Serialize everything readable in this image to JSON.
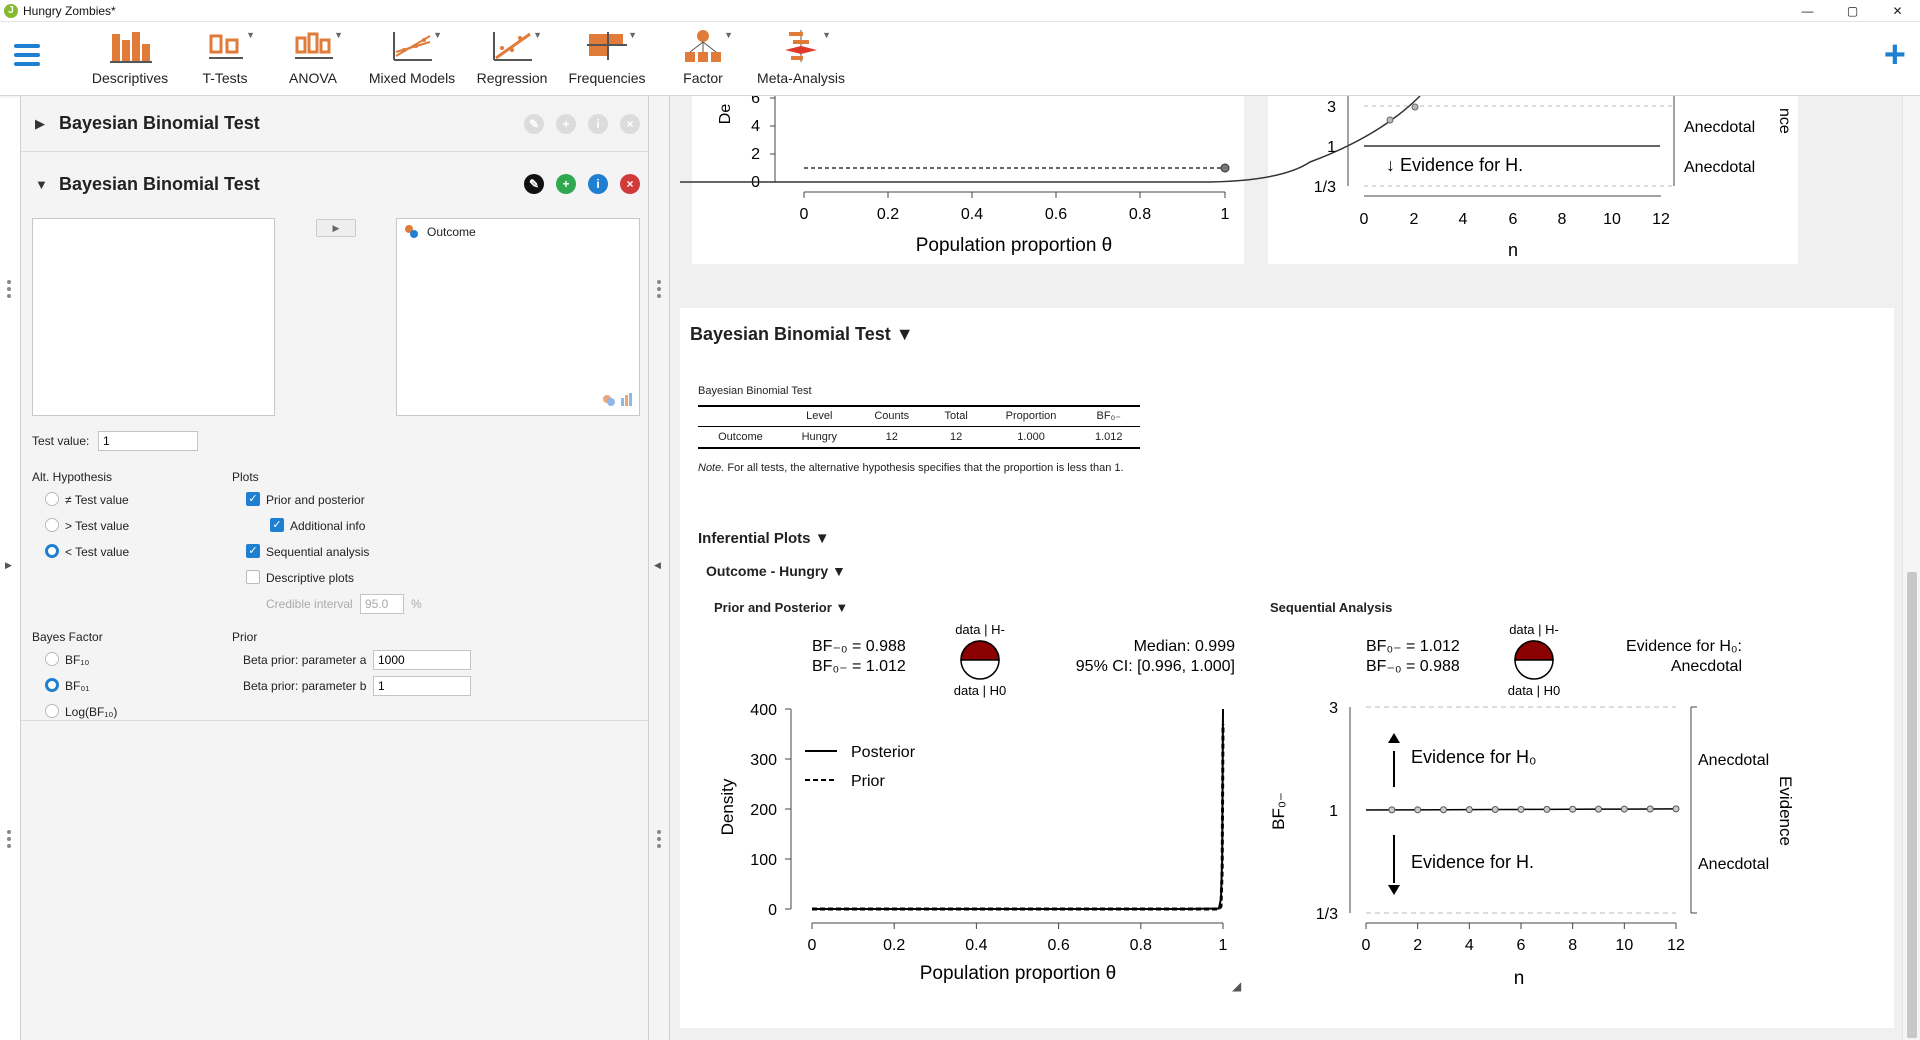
{
  "window": {
    "title": "Hungry Zombies*",
    "minimize": "—",
    "maximize": "▢",
    "close": "✕"
  },
  "ribbon": {
    "items": [
      {
        "label": "Descriptives"
      },
      {
        "label": "T-Tests"
      },
      {
        "label": "ANOVA"
      },
      {
        "label": "Mixed Models"
      },
      {
        "label": "Regression"
      },
      {
        "label": "Frequencies"
      },
      {
        "label": "Factor"
      },
      {
        "label": "Meta-Analysis"
      }
    ],
    "add": "+"
  },
  "options": {
    "collapsed_title": "Bayesian Binomial Test",
    "expanded_title": "Bayesian Binomial Test",
    "move_arrow": "▶",
    "assigned_variable": "Outcome",
    "test_value_label": "Test value:",
    "test_value": "1",
    "alt_hypothesis_title": "Alt. Hypothesis",
    "alt_hypothesis": [
      {
        "label": "≠ Test value",
        "checked": false
      },
      {
        "label": "> Test value",
        "checked": false
      },
      {
        "label": "< Test value",
        "checked": true
      }
    ],
    "plots_title": "Plots",
    "plots": [
      {
        "label": "Prior and posterior",
        "checked": true
      },
      {
        "label": "Additional info",
        "checked": true
      },
      {
        "label": "Sequential analysis",
        "checked": true
      },
      {
        "label": "Descriptive plots",
        "checked": false
      }
    ],
    "credible_interval_label": "Credible interval",
    "credible_interval_value": "95.0",
    "percent": "%",
    "bayes_factor_title": "Bayes Factor",
    "bayes_factor": [
      {
        "label": "BF₁₀",
        "checked": false
      },
      {
        "label": "BF₀₁",
        "checked": true
      },
      {
        "label": "Log(BF₁₀)",
        "checked": false
      }
    ],
    "prior_title": "Prior",
    "prior_a_label": "Beta prior: parameter a",
    "prior_a_value": "1000",
    "prior_b_label": "Beta prior: parameter b",
    "prior_b_value": "1"
  },
  "results": {
    "top_left_plot": {
      "xlabel": "Population proportion θ",
      "x_ticks": [
        "0",
        "0.2",
        "0.4",
        "0.6",
        "0.8",
        "1"
      ],
      "y_ticks": [
        "0",
        "2",
        "4",
        "6"
      ],
      "ylabel_partial": "De"
    },
    "top_right_plot": {
      "xlabel": "n",
      "x_ticks": [
        "0",
        "2",
        "4",
        "6",
        "8",
        "10",
        "12"
      ],
      "y_ticks": [
        "1/3",
        "1",
        "3"
      ],
      "labels": [
        "Anecdotal",
        "Anecdotal"
      ],
      "evidence_text": "Evidence for H.",
      "right_partial": "nce"
    },
    "section_title": "Bayesian Binomial Test ▼",
    "table": {
      "title": "Bayesian Binomial Test",
      "columns": [
        "",
        "Level",
        "Counts",
        "Total",
        "Proportion",
        "BF₀₋"
      ],
      "rows": [
        [
          "Outcome",
          "Hungry",
          "12",
          "12",
          "1.000",
          "1.012"
        ]
      ],
      "note_italic": "Note.",
      "note_text": " For all tests, the alternative hypothesis specifies that the proportion is less than 1."
    },
    "inferential_title": "Inferential Plots ▼",
    "outcome_title": "Outcome - Hungry ▼",
    "prior_posterior_title": "Prior and Posterior ▼",
    "sequential_title": "Sequential Analysis",
    "prior_posterior": {
      "bf_line1": "BF₋₀ = 0.988",
      "bf_line2": "BF₀₋ = 1.012",
      "pie_top": "data | H-",
      "pie_bottom": "data | H0",
      "median": "Median: 0.999",
      "ci": "95% CI: [0.996, 1.000]",
      "legend_posterior": "Posterior",
      "legend_prior": "Prior",
      "ylabel": "Density",
      "xlabel": "Population proportion θ",
      "x_ticks": [
        "0",
        "0.2",
        "0.4",
        "0.6",
        "0.8",
        "1"
      ],
      "y_ticks": [
        "0",
        "100",
        "200",
        "300",
        "400"
      ]
    },
    "sequential": {
      "bf_line1": "BF₀₋ = 1.012",
      "bf_line2": "BF₋₀ = 0.988",
      "pie_top": "data | H-",
      "pie_bottom": "data | H0",
      "evidence_line1": "Evidence for H₀:",
      "evidence_line2": "Anecdotal",
      "ylabel": "BF₀₋",
      "xlabel": "n",
      "x_ticks": [
        "0",
        "2",
        "4",
        "6",
        "8",
        "10",
        "12"
      ],
      "y_ticks": [
        "1/3",
        "1",
        "3"
      ],
      "evidence_h0": "Evidence for H₀",
      "evidence_hminus": "Evidence for H.",
      "anecdotal_top": "Anecdotal",
      "anecdotal_bottom": "Anecdotal",
      "right_label": "Evidence"
    }
  },
  "chart_data": [
    {
      "type": "line",
      "title": "Prior and Posterior",
      "xlabel": "Population proportion θ",
      "ylabel": "Density",
      "xlim": [
        0,
        1
      ],
      "ylim": [
        0,
        400
      ],
      "series": [
        {
          "name": "Posterior",
          "x": [
            0,
            0.9,
            0.99,
            0.995,
            0.998,
            1.0
          ],
          "values": [
            0,
            0,
            1,
            20,
            100,
            400
          ]
        },
        {
          "name": "Prior",
          "x": [
            0,
            0.9,
            0.99,
            0.995,
            0.998,
            1.0
          ],
          "values": [
            0,
            0,
            0,
            5,
            80,
            370
          ]
        }
      ]
    },
    {
      "type": "line",
      "title": "Sequential Analysis",
      "xlabel": "n",
      "ylabel": "BF₀₋",
      "xlim": [
        0,
        12
      ],
      "series": [
        {
          "name": "BF₀₋",
          "x": [
            1,
            2,
            3,
            4,
            5,
            6,
            7,
            8,
            9,
            10,
            11,
            12
          ],
          "values": [
            1.001,
            1.002,
            1.003,
            1.004,
            1.005,
            1.006,
            1.007,
            1.008,
            1.009,
            1.01,
            1.011,
            1.012
          ]
        }
      ]
    }
  ]
}
